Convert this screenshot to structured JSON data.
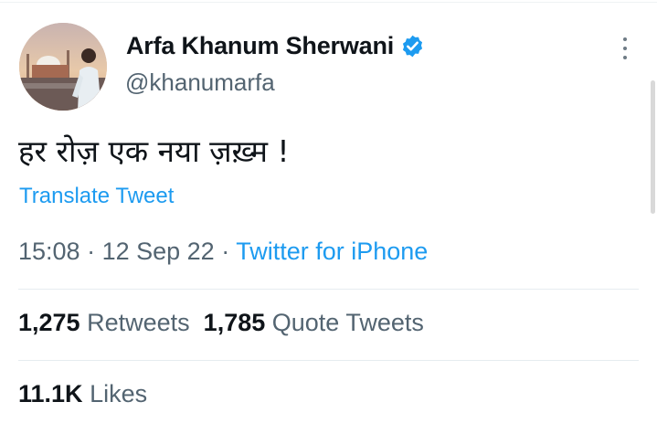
{
  "author": {
    "display_name": "Arfa Khanum Sherwani",
    "handle": "@khanumarfa",
    "verified": true
  },
  "tweet": {
    "text": "हर रोज़ एक नया ज़ख़्म !",
    "translate_label": "Translate Tweet",
    "time": "15:08",
    "separator": " · ",
    "date": "12 Sep 22",
    "source": "Twitter for iPhone"
  },
  "stats": {
    "retweets_count": "1,275",
    "retweets_label": "Retweets",
    "quote_count": "1,785",
    "quote_label": "Quote Tweets",
    "likes_count": "11.1K",
    "likes_label": "Likes"
  },
  "colors": {
    "accent": "#1d9bf0",
    "secondary_text": "#536471",
    "primary_text": "#0f1419"
  },
  "icons": {
    "verified": "verified-badge-icon",
    "more": "more-options-icon"
  }
}
